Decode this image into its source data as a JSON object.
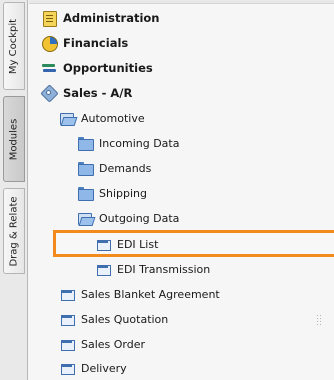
{
  "side_tabs": [
    {
      "label": "My Cockpit"
    },
    {
      "label": "Modules"
    },
    {
      "label": "Drag & Relate"
    }
  ],
  "tree": {
    "administration": "Administration",
    "financials": "Financials",
    "opportunities": "Opportunities",
    "sales_ar": "Sales - A/R",
    "automotive": "Automotive",
    "incoming_data": "Incoming Data",
    "demands": "Demands",
    "shipping": "Shipping",
    "outgoing_data": "Outgoing Data",
    "edi_list": "EDI List",
    "edi_transmission": "EDI Transmission",
    "sales_blanket_agreement": "Sales Blanket Agreement",
    "sales_quotation": "Sales Quotation",
    "sales_order": "Sales Order",
    "delivery": "Delivery"
  },
  "highlight_color": "#f28a1e",
  "highlighted_item": "EDI List"
}
